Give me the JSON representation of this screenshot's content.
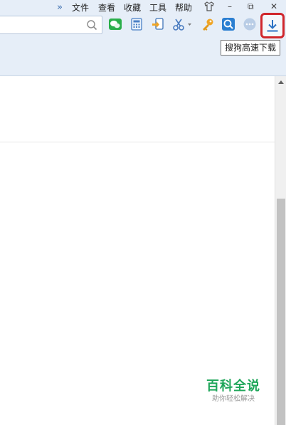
{
  "menu": {
    "more": "»",
    "items": [
      "文件",
      "查看",
      "收藏",
      "工具",
      "帮助"
    ]
  },
  "window": {
    "minimize": "–",
    "restore": "⧉",
    "close": "✕"
  },
  "toolbar": {
    "icons": [
      "wechat-icon",
      "calculator-icon",
      "screen-capture-icon",
      "scissors-icon",
      "key-icon",
      "zoom-icon",
      "more-icon",
      "download-icon"
    ],
    "download_tooltip": "搜狗高速下载"
  },
  "colors": {
    "chrome_bg": "#e6eef8",
    "highlight_border": "#d0262c",
    "watermark_green": "#1fa65a"
  },
  "watermark": {
    "title": "百科全说",
    "subtitle": "助你轻松解决"
  }
}
